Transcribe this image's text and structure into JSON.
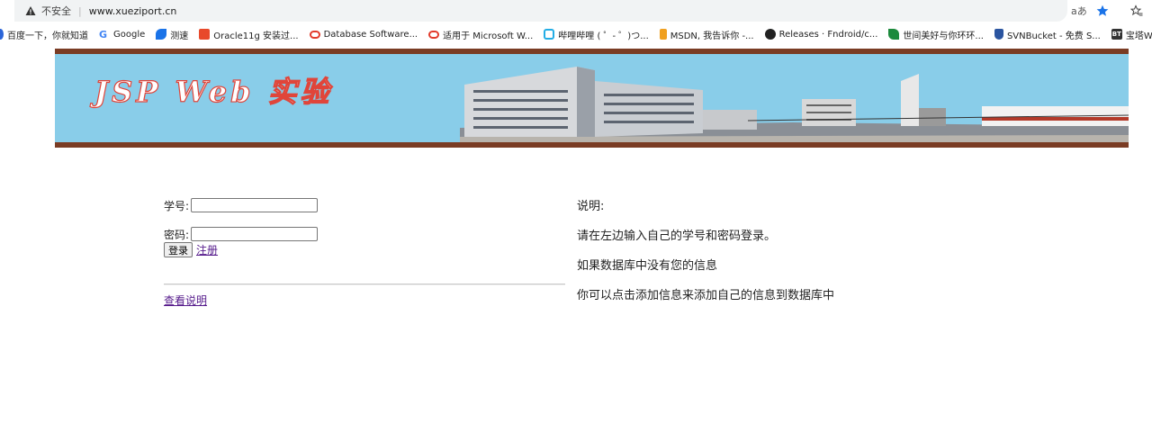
{
  "browser": {
    "insecure_label": "不安全",
    "separator": "|",
    "url": "www.xueziport.cn",
    "read_aloud": "aあ"
  },
  "bookmarks": [
    {
      "label": "百度一下，你就知道",
      "icon": "paw-icon",
      "color": "#2b65d8"
    },
    {
      "label": "Google",
      "icon": "google-icon",
      "color": "#4285f4"
    },
    {
      "label": "测速",
      "icon": "speed-icon",
      "color": "#1a73e8"
    },
    {
      "label": "Oracle11g 安装过...",
      "icon": "c-icon",
      "color": "#e8492b"
    },
    {
      "label": "Database Software...",
      "icon": "oracle-icon",
      "color": "#e23b2b"
    },
    {
      "label": "适用于 Microsoft W...",
      "icon": "oracle-icon",
      "color": "#e23b2b"
    },
    {
      "label": "哔哩哔哩 ( ゜- ゜)つ...",
      "icon": "bilibili-icon",
      "color": "#23ade5"
    },
    {
      "label": "MSDN, 我告诉你 -...",
      "icon": "msdn-icon",
      "color": "#f0a020"
    },
    {
      "label": "Releases · Fndroid/c...",
      "icon": "github-icon",
      "color": "#222222"
    },
    {
      "label": "世间美好与你环环...",
      "icon": "leaf-icon",
      "color": "#1c8a3c"
    },
    {
      "label": "SVNBucket - 免费 S...",
      "icon": "bucket-icon",
      "color": "#2b55a0"
    },
    {
      "label": "宝塔Windows面板",
      "icon": "bt-icon",
      "color": "#333333"
    }
  ],
  "banner": {
    "title": "JSP Web 实验"
  },
  "login": {
    "id_label": "学号:",
    "id_value": "",
    "password_label": "密码:",
    "password_value": "",
    "login_button": "登录",
    "register_link": "注册",
    "help_link": "查看说明"
  },
  "info": {
    "heading": "说明:",
    "line1": "请在左边输入自己的学号和密码登录。",
    "line2": "如果数据库中没有您的信息",
    "line3": "你可以点击添加信息来添加自己的信息到数据库中"
  }
}
